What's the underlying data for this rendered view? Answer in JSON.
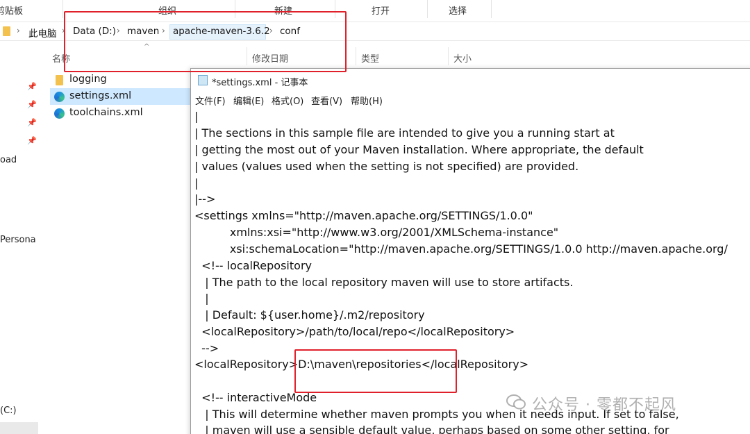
{
  "ribbon": {
    "groups": [
      "剪贴板",
      "组织",
      "新建",
      "打开",
      "选择"
    ]
  },
  "address_bar": {
    "crumbs": [
      "此电脑",
      "Data (D:)",
      "maven",
      "apache-maven-3.6.2",
      "conf"
    ]
  },
  "nav_pane": {
    "partial_labels": [
      "oad",
      "Persona",
      "(C:)"
    ]
  },
  "columns": [
    "名称",
    "修改日期",
    "类型",
    "大小"
  ],
  "files": [
    {
      "name": "logging",
      "icon": "folder-icon"
    },
    {
      "name": "settings.xml",
      "icon": "edge-icon",
      "selected": true
    },
    {
      "name": "toolchains.xml",
      "icon": "edge-icon"
    }
  ],
  "notepad": {
    "title": "*settings.xml - 记事本",
    "menu": [
      "文件(F)",
      "编辑(E)",
      "格式(O)",
      "查看(V)",
      "帮助(H)"
    ],
    "lines": [
      "|",
      "| The sections in this sample file are intended to give you a running start at",
      "| getting the most out of your Maven installation. Where appropriate, the default",
      "| values (values used when the setting is not specified) are provided.",
      "|",
      "|-->",
      "<settings xmlns=\"http://maven.apache.org/SETTINGS/1.0.0\"",
      "          xmlns:xsi=\"http://www.w3.org/2001/XMLSchema-instance\"",
      "          xsi:schemaLocation=\"http://maven.apache.org/SETTINGS/1.0.0 http://maven.apache.org/",
      "  <!-- localRepository",
      "   | The path to the local repository maven will use to store artifacts.",
      "   |",
      "   | Default: ${user.home}/.m2/repository",
      "  <localRepository>/path/to/local/repo</localRepository>",
      "  -->",
      "<localRepository>D:\\maven\\repositories</localRepository>",
      "",
      "  <!-- interactiveMode",
      "   | This will determine whether maven prompts you when it needs input. If set to false,",
      "   | maven will use a sensible default value, perhaps based on some other setting, for"
    ]
  },
  "watermark": "公众号 · 零都不起风",
  "colors": {
    "annotation_red": "#e0202a",
    "selection_blue": "#cde8ff",
    "folder_yellow": "#f3c24e"
  }
}
